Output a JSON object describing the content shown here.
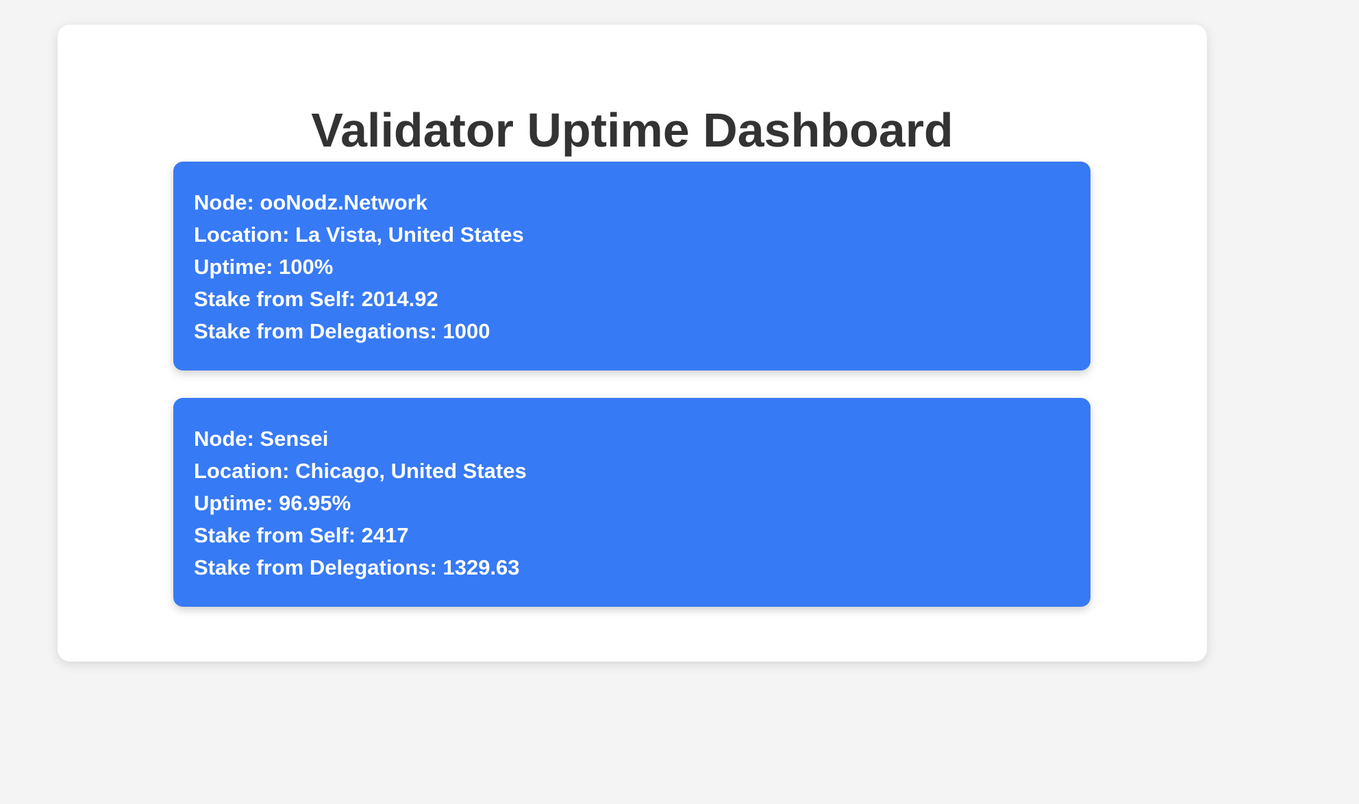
{
  "page": {
    "title": "Validator Uptime Dashboard"
  },
  "validators": [
    {
      "node": "Node: ooNodz.Network",
      "location": "Location: La Vista, United States",
      "uptime": "Uptime: 100%",
      "stake_self": "Stake from Self: 2014.92",
      "stake_delegations": "Stake from Delegations: 1000"
    },
    {
      "node": "Node: Sensei",
      "location": "Location: Chicago, United States",
      "uptime": "Uptime: 96.95%",
      "stake_self": "Stake from Self: 2417",
      "stake_delegations": "Stake from Delegations: 1329.63"
    }
  ],
  "colors": {
    "background": "#f4f4f4",
    "panel": "#ffffff",
    "card": "#377af5",
    "title": "#333333",
    "card_text": "#ffffff"
  }
}
